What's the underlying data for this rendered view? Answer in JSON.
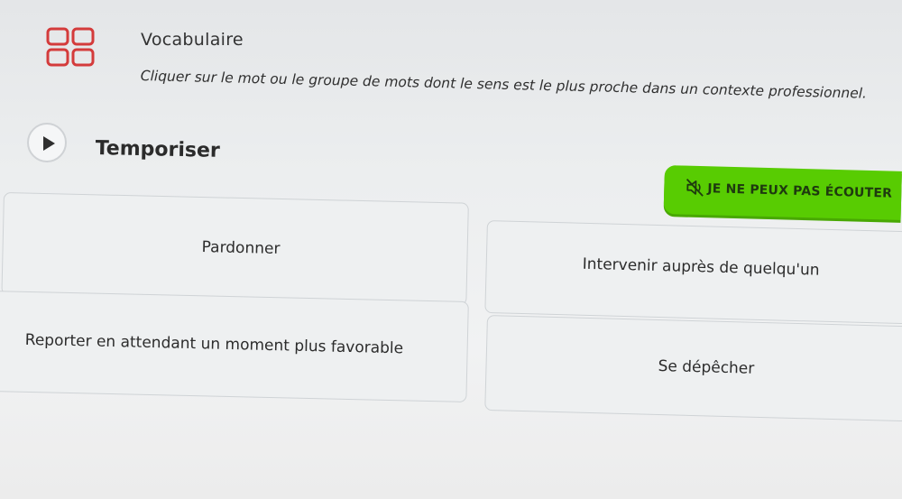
{
  "header": {
    "icon": "grid-cards-icon",
    "title": "Vocabulaire",
    "instruction": "Cliquer sur le mot ou le groupe de mots dont le sens est le plus proche dans un contexte professionnel."
  },
  "prompt": {
    "play_icon": "play-icon",
    "word": "Temporiser"
  },
  "cant_listen": {
    "icon": "speaker-muted-icon",
    "label": "JE NE PEUX PAS ÉCOUTER",
    "color": "#58cc02"
  },
  "options": [
    {
      "label": "Pardonner"
    },
    {
      "label": "Intervenir auprès de quelqu'un"
    },
    {
      "label": "Reporter en attendant un moment plus favorable"
    },
    {
      "label": "Se dépêcher"
    }
  ]
}
